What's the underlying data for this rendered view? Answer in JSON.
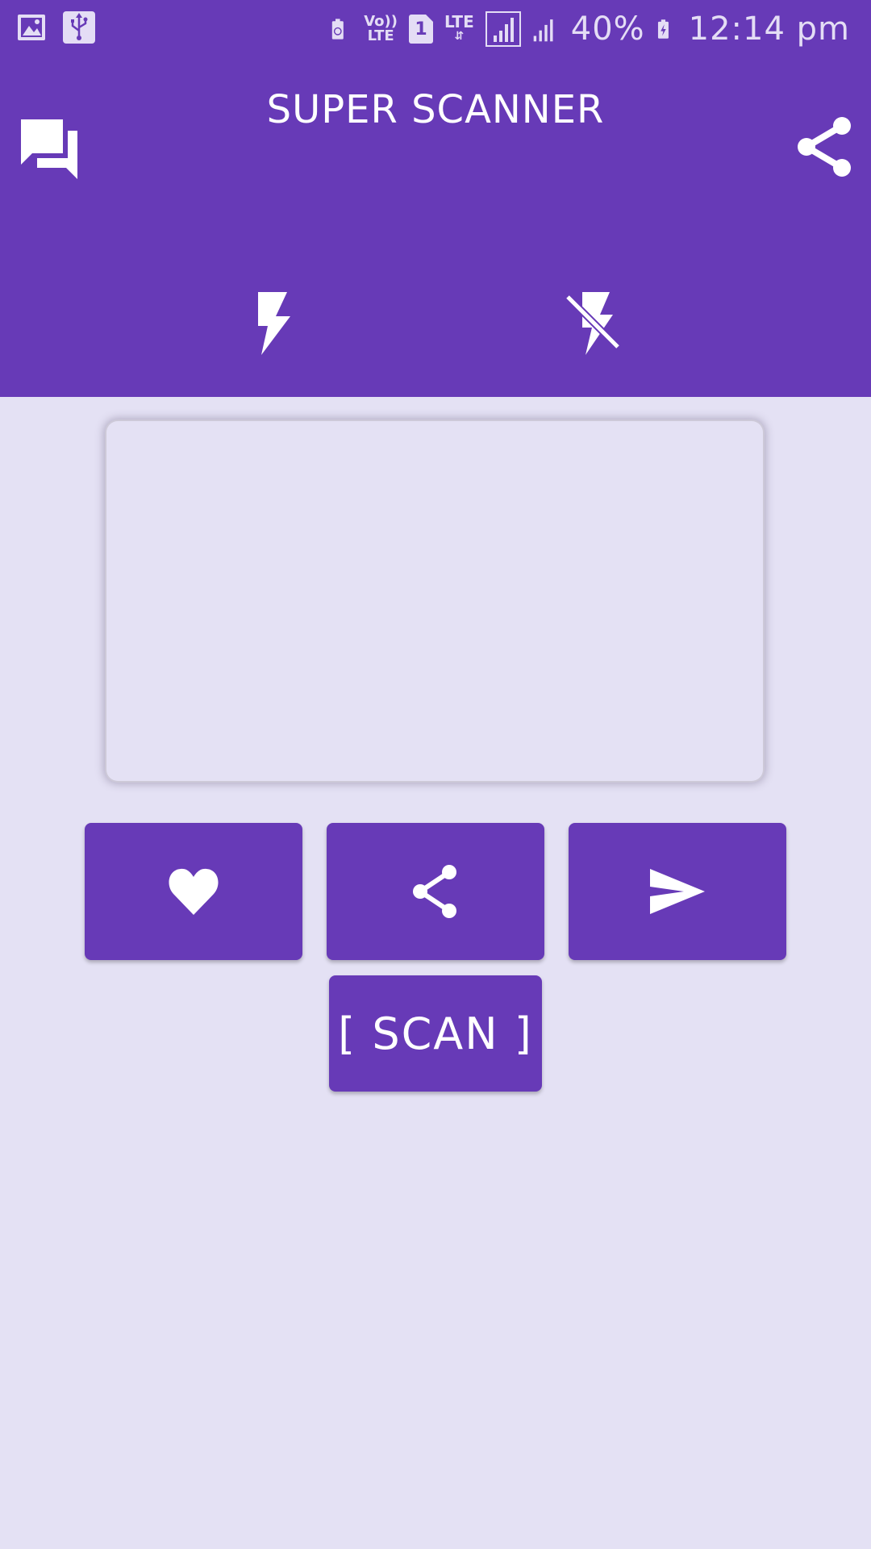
{
  "status_bar": {
    "lte_top": "Vo))",
    "lte_bottom": "LTE",
    "sim": "1",
    "lte2": "LTE",
    "battery": "40%",
    "time": "12:14 pm",
    "icons": [
      "image-icon",
      "usb-icon",
      "battery-saver-icon",
      "volte-icon",
      "sim-icon",
      "lte-data-icon",
      "signal-icon",
      "signal-icon",
      "charging-battery-icon"
    ]
  },
  "header": {
    "title": "SUPER SCANNER",
    "left_icon": "chat-icon",
    "right_icon": "share-icon",
    "flash_on_icon": "flash-on-icon",
    "flash_off_icon": "flash-off-icon"
  },
  "actions": {
    "favorite_icon": "heart-icon",
    "share_icon": "share-icon",
    "send_icon": "send-icon",
    "scan_label": "[ SCAN ]"
  },
  "colors": {
    "primary": "#673ab7",
    "background": "#e4e1f4",
    "on_primary": "#ffffff"
  }
}
